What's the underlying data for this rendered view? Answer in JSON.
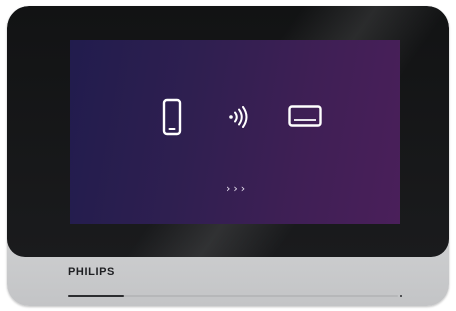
{
  "device": {
    "brand": "PHILIPS",
    "bezel_color": "#141517",
    "frame_color": "#d9dadb",
    "screen_gradient": [
      "#211c4d",
      "#4a1f5a"
    ]
  },
  "screen": {
    "icons": [
      "smartphone-icon",
      "wireless-signal-icon",
      "tablet-icon"
    ],
    "next_indicator": "›››"
  },
  "touch_bar": {
    "progress": 0.17
  }
}
